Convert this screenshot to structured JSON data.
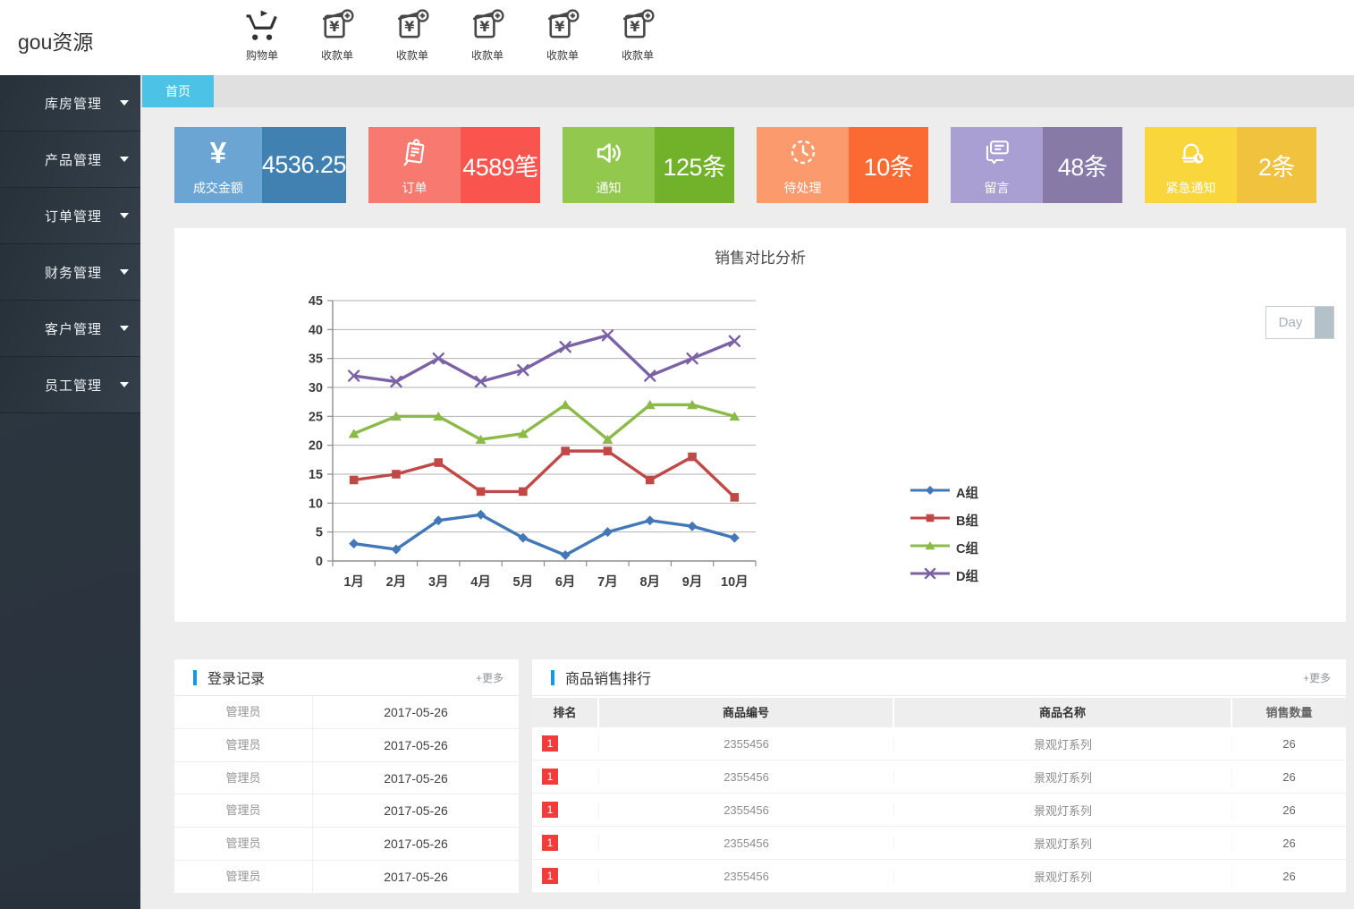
{
  "brand": "gou资源",
  "header": {
    "actions": [
      {
        "icon": "cart-icon",
        "label": "购物单"
      },
      {
        "icon": "receipt-add-icon",
        "label": "收款单"
      },
      {
        "icon": "receipt-add-icon",
        "label": "收款单"
      },
      {
        "icon": "receipt-add-icon",
        "label": "收款单"
      },
      {
        "icon": "receipt-add-icon",
        "label": "收款单"
      },
      {
        "icon": "receipt-add-icon",
        "label": "收款单"
      }
    ]
  },
  "sidebar": {
    "items": [
      {
        "label": "库房管理"
      },
      {
        "label": "产品管理"
      },
      {
        "label": "订单管理"
      },
      {
        "label": "财务管理"
      },
      {
        "label": "客户管理"
      },
      {
        "label": "员工管理"
      }
    ]
  },
  "tabs": {
    "active": "首页"
  },
  "stat_cards": [
    {
      "icon": "yen-icon",
      "glyph": "¥",
      "label": "成交金额",
      "value": "4536.25",
      "color_light": "#6aa5d3",
      "color_dark": "#4181b1"
    },
    {
      "icon": "order-note-icon",
      "label": "订单",
      "value": "4589笔",
      "color_light": "#f7796f",
      "color_dark": "#f9544d"
    },
    {
      "icon": "speaker-icon",
      "label": "通知",
      "value": "125条",
      "color_light": "#92c84d",
      "color_dark": "#72b22a"
    },
    {
      "icon": "clock-icon",
      "label": "待处理",
      "value": "10条",
      "color_light": "#fb9b6d",
      "color_dark": "#fa6a32"
    },
    {
      "icon": "chat-icon",
      "label": "留言",
      "value": "48条",
      "color_light": "#a99fd2",
      "color_dark": "#877aa6"
    },
    {
      "icon": "alarm-icon",
      "label": "紧急通知",
      "value": "2条",
      "color_light": "#f8d63c",
      "color_dark": "#f0c23e"
    }
  ],
  "chart_panel": {
    "title": "销售对比分析",
    "day_button": "Day"
  },
  "chart_data": {
    "type": "line",
    "title": "销售对比分析",
    "categories": [
      "1月",
      "2月",
      "3月",
      "4月",
      "5月",
      "6月",
      "7月",
      "8月",
      "9月",
      "10月"
    ],
    "series": [
      {
        "name": "A组",
        "color": "#4277b8",
        "marker": "diamond",
        "values": [
          3,
          2,
          7,
          8,
          4,
          1,
          5,
          7,
          6,
          4
        ]
      },
      {
        "name": "B组",
        "color": "#c04846",
        "marker": "square",
        "values": [
          14,
          15,
          17,
          12,
          12,
          19,
          19,
          14,
          18,
          11
        ]
      },
      {
        "name": "C组",
        "color": "#8cba49",
        "marker": "triangle",
        "values": [
          22,
          25,
          25,
          21,
          22,
          27,
          21,
          27,
          27,
          25
        ]
      },
      {
        "name": "D组",
        "color": "#7b61a5",
        "marker": "x",
        "values": [
          32,
          31,
          35,
          31,
          33,
          37,
          39,
          32,
          35,
          38
        ]
      }
    ],
    "ylim": [
      0,
      45
    ],
    "ytick": 5,
    "grid": true,
    "legend_position": "right"
  },
  "login_panel": {
    "title": "登录记录",
    "more_label": "+更多",
    "rows": [
      {
        "user": "管理员",
        "date": "2017-05-26"
      },
      {
        "user": "管理员",
        "date": "2017-05-26"
      },
      {
        "user": "管理员",
        "date": "2017-05-26"
      },
      {
        "user": "管理员",
        "date": "2017-05-26"
      },
      {
        "user": "管理员",
        "date": "2017-05-26"
      },
      {
        "user": "管理员",
        "date": "2017-05-26"
      }
    ]
  },
  "sales_panel": {
    "title": "商品销售排行",
    "more_label": "+更多",
    "columns": [
      "排名",
      "商品编号",
      "商品名称",
      "销售数量"
    ],
    "rows": [
      {
        "rank": "1",
        "code": "2355456",
        "name": "景观灯系列",
        "qty": "26"
      },
      {
        "rank": "1",
        "code": "2355456",
        "name": "景观灯系列",
        "qty": "26"
      },
      {
        "rank": "1",
        "code": "2355456",
        "name": "景观灯系列",
        "qty": "26"
      },
      {
        "rank": "1",
        "code": "2355456",
        "name": "景观灯系列",
        "qty": "26"
      },
      {
        "rank": "1",
        "code": "2355456",
        "name": "景观灯系列",
        "qty": "26"
      }
    ]
  }
}
